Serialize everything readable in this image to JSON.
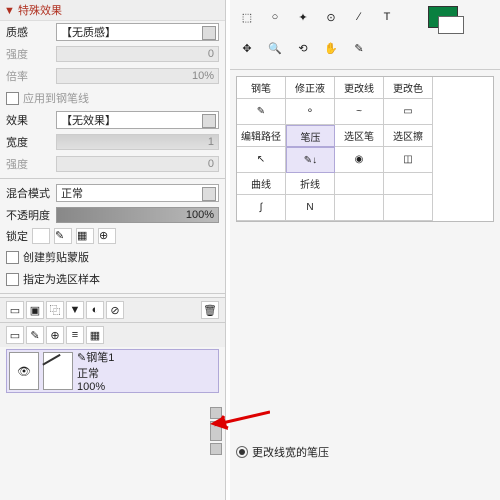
{
  "special_effects": {
    "title": "▼ 特殊效果",
    "texture_lbl": "质感",
    "texture_val": "【无质感】",
    "intensity1_lbl": "强度",
    "intensity1_val": "0",
    "rate_lbl": "倍率",
    "rate_val": "10%",
    "apply_lbl": "应用到钢笔线",
    "effect_lbl": "效果",
    "effect_val": "【无效果】",
    "width_lbl": "宽度",
    "width_val": "1",
    "intensity2_lbl": "强度",
    "intensity2_val": "0"
  },
  "blend": {
    "mode_lbl": "混合模式",
    "mode_val": "正常",
    "opacity_lbl": "不透明度",
    "opacity_val": "100%",
    "lock_lbl": "锁定",
    "cb1": "创建剪贴蒙版",
    "cb2": "指定为选区样本"
  },
  "layer": {
    "name": "✎钢笔1",
    "mode": "正常",
    "opacity": "100%"
  },
  "tools": {
    "row1": [
      {
        "n": "select-rect-icon",
        "g": "⬚"
      },
      {
        "n": "select-ellipse-icon",
        "g": "○"
      },
      {
        "n": "wand-icon",
        "g": "✦"
      },
      {
        "n": "lasso-icon",
        "g": "⊙"
      },
      {
        "n": "line-icon",
        "g": "∕"
      },
      {
        "n": "text-icon",
        "g": "T"
      }
    ],
    "row2": [
      {
        "n": "move-icon",
        "g": "✥"
      },
      {
        "n": "zoom-icon",
        "g": "🔍"
      },
      {
        "n": "rotate-icon",
        "g": "⟲"
      },
      {
        "n": "hand-icon",
        "g": "✋"
      },
      {
        "n": "eyedrop-icon",
        "g": "✎"
      }
    ]
  },
  "pentabs": {
    "r1": [
      "钢笔",
      "修正液",
      "更改线",
      "更改色"
    ],
    "r2": [
      "编辑路径",
      "笔压",
      "选区笔",
      "选区擦"
    ],
    "r3": [
      "曲线",
      "折线"
    ],
    "i1": [
      "✎",
      "⚬",
      "~",
      "▭"
    ],
    "i2": [
      "↖",
      "✎↓",
      "◉",
      "◫"
    ],
    "i3": [
      "∫",
      "N"
    ]
  },
  "radio": "更改线宽的笔压",
  "swatch": "#0a8040"
}
